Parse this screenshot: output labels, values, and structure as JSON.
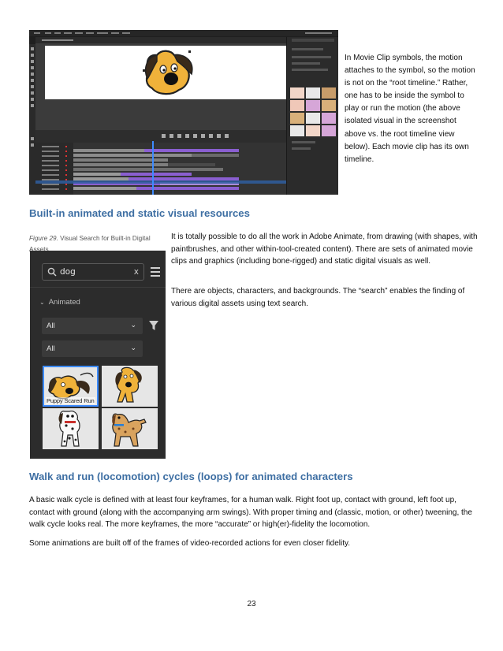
{
  "top_note": "In Movie Clip symbols, the motion attaches to the symbol, so the motion is not on the “root timeline.” Rather, one has to be inside the symbol to play or run the motion (the above isolated visual in the screenshot above vs. the root timeline view below). Each movie clip has its own timeline.",
  "section1": {
    "heading": "Built-in animated and static visual resources",
    "figure_label": "Figure 29.",
    "figure_caption": "Visual Search for Built-in Digital Assets",
    "para1": "It is totally possible to do all the work in Adobe Animate, from drawing (with shapes, with paintbrushes, and other within-tool-created content).  There are sets of animated movie clips and graphics (including bone-rigged) and static digital visuals as well.",
    "para2": "There are objects, characters, and backgrounds.  The “search” enables the finding of various digital assets using text search."
  },
  "search_panel": {
    "search_value": "dog",
    "clear_label": "x",
    "section_label": "Animated",
    "filter1_value": "All",
    "filter2_value": "All",
    "selected_asset_caption": "Puppy Scared Run",
    "icons": [
      "search-icon",
      "clear-icon",
      "list-view-icon",
      "chevron-down-icon",
      "filter-icon"
    ]
  },
  "section2": {
    "heading": "Walk and run (locomotion) cycles (loops) for animated characters",
    "para1": "A basic walk cycle is defined with at least four keyframes, for a human walk.  Right foot up, contact with ground, left foot up, contact with ground (along with the accompanying arm swings).  With proper timing and (classic, motion, or other) tweening, the walk cycle looks real.  The more keyframes, the more “accurate” or high(er)-fidelity the locomotion.",
    "para2": "Some animations are built off of the frames of video-recorded actions for even closer fidelity."
  },
  "page_number": "23",
  "colors": {
    "heading": "#3e6fa3",
    "dark_ui": "#2c2c2c",
    "selection": "#3d8bff",
    "purple_tween": "#8a5fd0"
  }
}
